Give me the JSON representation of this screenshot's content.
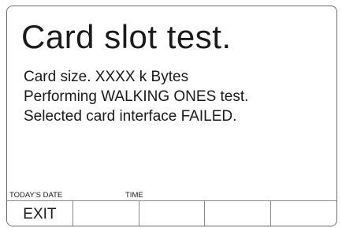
{
  "title": "Card slot test.",
  "messages": [
    "Card size. XXXX k Bytes",
    "Performing WALKING ONES test.",
    "Selected card interface FAILED."
  ],
  "status": {
    "date_label": "TODAY'S DATE",
    "time_label": "TIME"
  },
  "softkeys": [
    "EXIT",
    "",
    "",
    "",
    ""
  ]
}
